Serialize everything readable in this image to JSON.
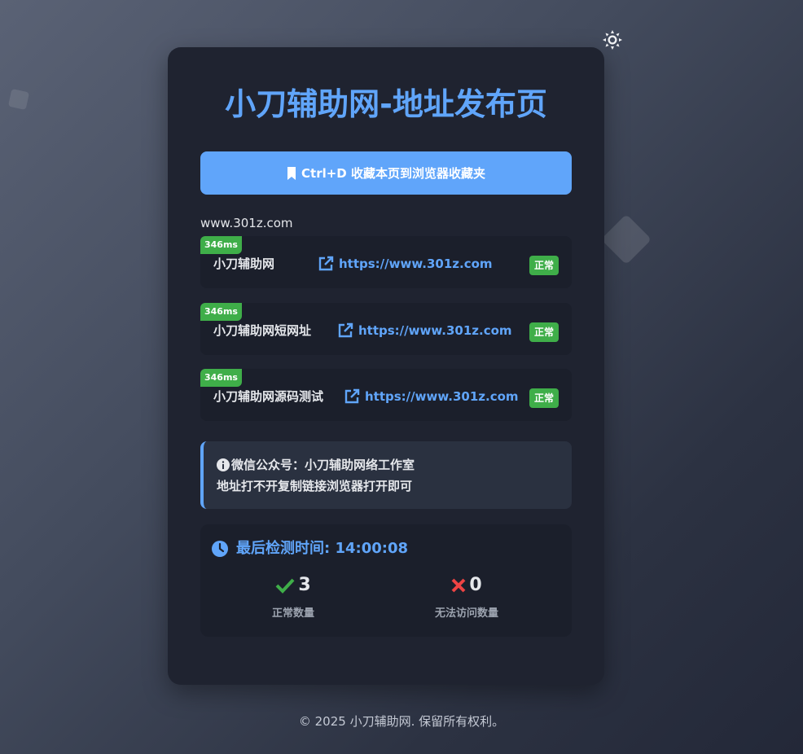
{
  "page": {
    "title": "小刀辅助网-地址发布页",
    "bookmark_button": "Ctrl+D 收藏本页到浏览器收藏夹",
    "domain_label": "www.301z.com"
  },
  "sites": [
    {
      "latency": "346ms",
      "name": "小刀辅助网",
      "url": "https://www.301z.com",
      "status": "正常"
    },
    {
      "latency": "346ms",
      "name": "小刀辅助网短网址",
      "url": "https://www.301z.com",
      "status": "正常"
    },
    {
      "latency": "346ms",
      "name": "小刀辅助网源码测试",
      "url": "https://www.301z.com",
      "status": "正常"
    }
  ],
  "notice": {
    "line1": "微信公众号：小刀辅助网络工作室",
    "line2": "地址打不开复制链接浏览器打开即可"
  },
  "stats": {
    "last_check": "最后检测时间: 14:00:08",
    "normal_count": "3",
    "normal_label": "正常数量",
    "failed_count": "0",
    "failed_label": "无法访问数量"
  },
  "footer": "© 2025 小刀辅助网. 保留所有权利。",
  "colors": {
    "accent": "#60a5fa",
    "success": "#3fae49",
    "error": "#ef4444",
    "card": "#1f2330"
  },
  "icons": [
    "sun-icon",
    "bookmark-icon",
    "external-link-icon",
    "info-icon",
    "clock-icon",
    "check-icon",
    "x-icon"
  ]
}
